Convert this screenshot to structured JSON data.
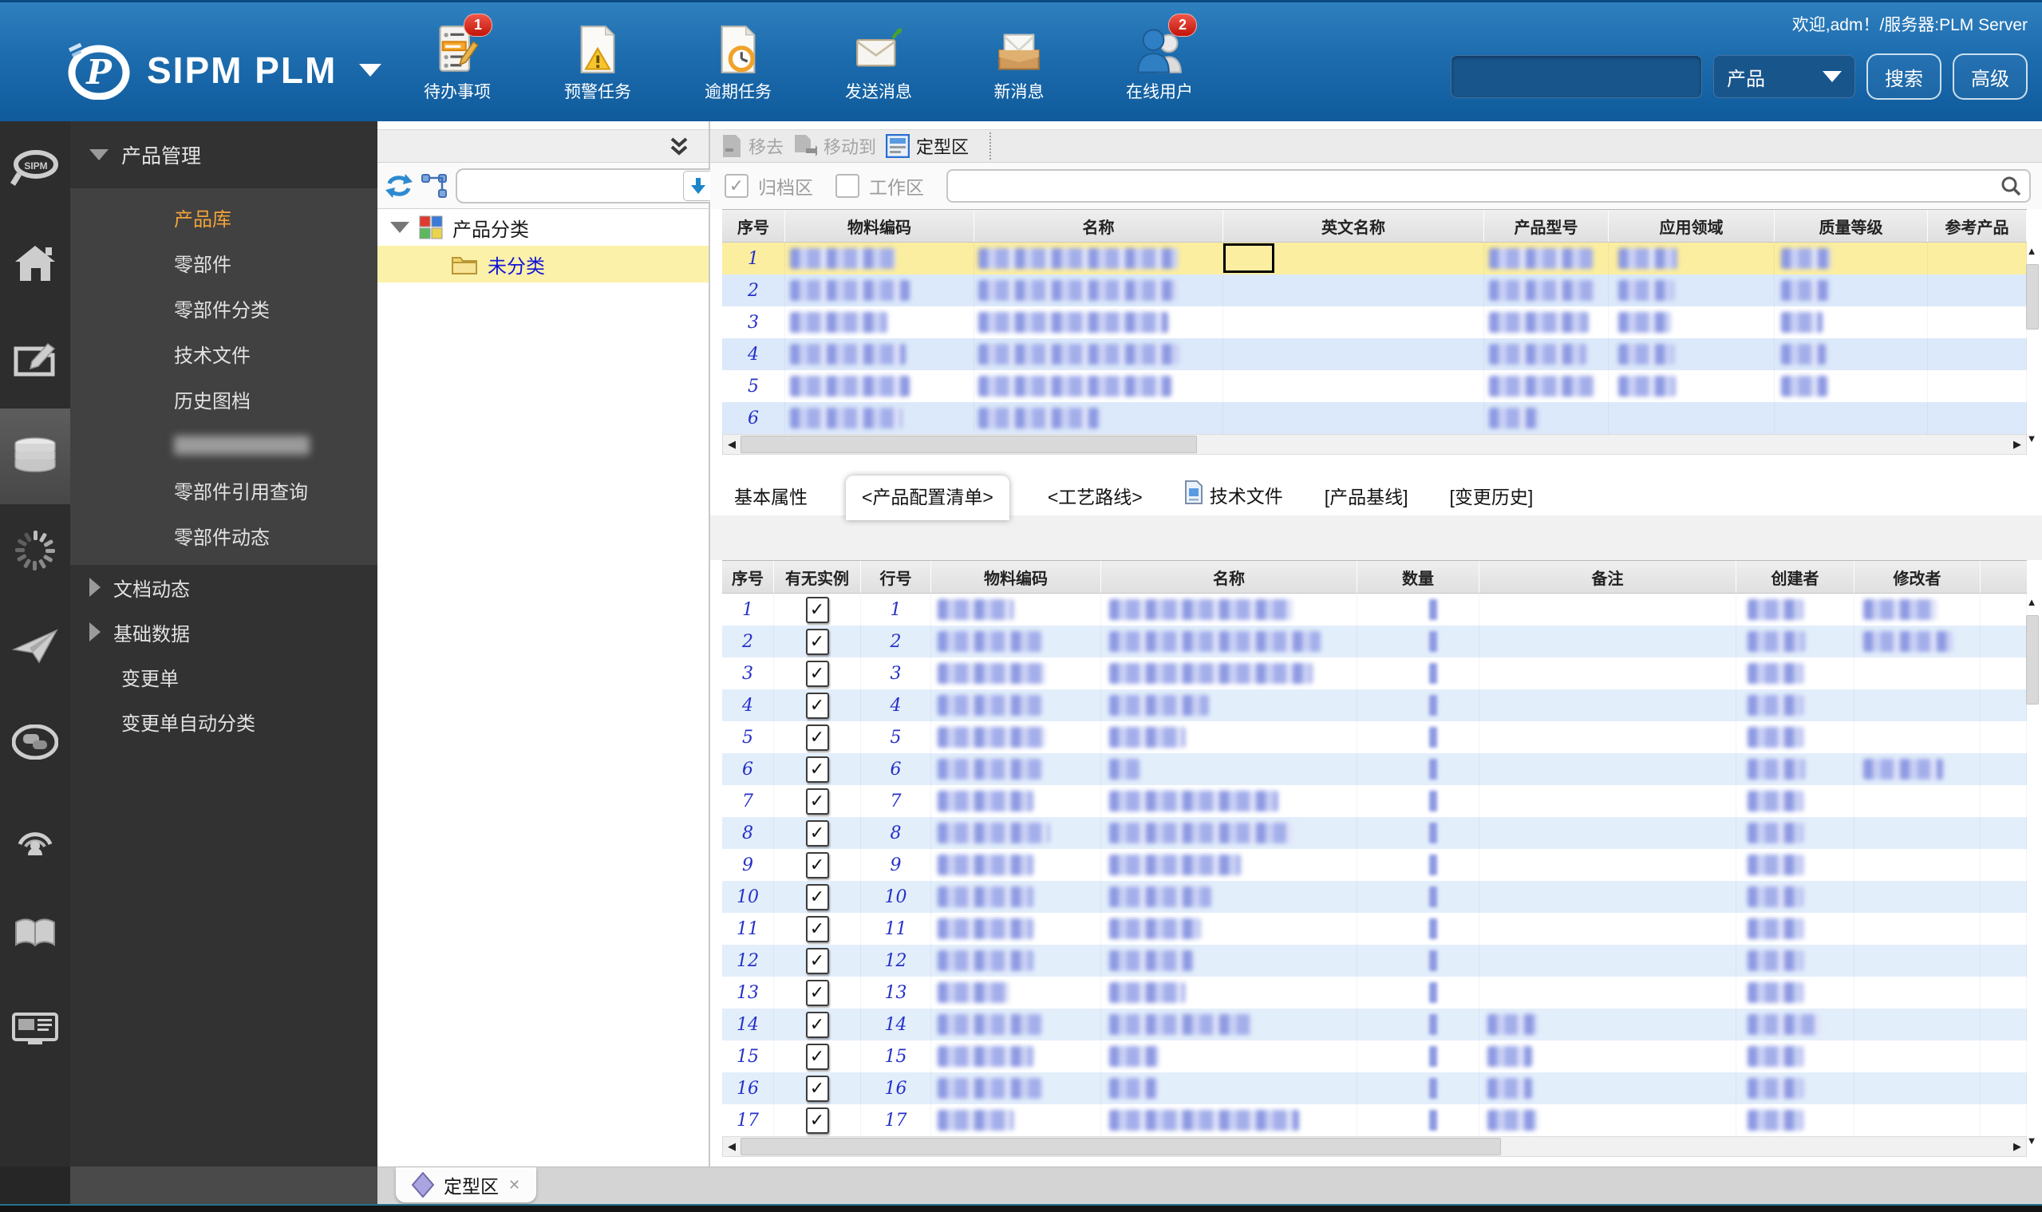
{
  "header": {
    "logo_text": "SIPM PLM",
    "welcome_text": "欢迎,adm！/服务器:PLM Server",
    "toolbar_items": [
      {
        "label": "待办事项",
        "icon": "todo-list-icon",
        "badge": "1"
      },
      {
        "label": "预警任务",
        "icon": "alert-task-icon",
        "badge": ""
      },
      {
        "label": "逾期任务",
        "icon": "overdue-task-icon",
        "badge": ""
      },
      {
        "label": "发送消息",
        "icon": "send-message-icon",
        "badge": ""
      },
      {
        "label": "新消息",
        "icon": "new-message-icon",
        "badge": ""
      },
      {
        "label": "在线用户",
        "icon": "online-users-icon",
        "badge": "2"
      }
    ],
    "search": {
      "value": "",
      "category": "产品",
      "search_btn": "搜索",
      "advanced_btn": "高级"
    }
  },
  "iconbar": {
    "items": [
      {
        "name": "sipm-search-icon",
        "selected": false
      },
      {
        "name": "home-icon",
        "selected": false
      },
      {
        "name": "edit-icon",
        "selected": false
      },
      {
        "name": "database-icon",
        "selected": true
      },
      {
        "name": "spinner-icon",
        "selected": false
      },
      {
        "name": "send-plane-icon",
        "selected": false
      },
      {
        "name": "chat-icon",
        "selected": false
      },
      {
        "name": "broadcast-icon",
        "selected": false
      },
      {
        "name": "book-icon",
        "selected": false
      },
      {
        "name": "workstation-icon",
        "selected": false
      }
    ]
  },
  "sidebar": {
    "root": {
      "label": "产品管理",
      "expanded": true
    },
    "children": [
      {
        "label": "产品库",
        "active": true,
        "redacted": false
      },
      {
        "label": "零部件",
        "active": false,
        "redacted": false
      },
      {
        "label": "零部件分类",
        "active": false,
        "redacted": false
      },
      {
        "label": "技术文件",
        "active": false,
        "redacted": false
      },
      {
        "label": "历史图档",
        "active": false,
        "redacted": false
      },
      {
        "label": "",
        "active": false,
        "redacted": true
      },
      {
        "label": "零部件引用查询",
        "active": false,
        "redacted": false
      },
      {
        "label": "零部件动态",
        "active": false,
        "redacted": false
      }
    ],
    "sections": [
      {
        "label": "文档动态",
        "collapsed": true
      },
      {
        "label": "基础数据",
        "collapsed": true
      },
      {
        "label": "变更单",
        "collapsed": false
      },
      {
        "label": "变更单自动分类",
        "collapsed": false
      }
    ]
  },
  "tree": {
    "root_label": "产品分类",
    "child_label": "未分类"
  },
  "content": {
    "toolbar": {
      "remove": "移去",
      "move_to": "移动到",
      "typed_area": "定型区"
    },
    "filter": {
      "archive": "归档区",
      "work": "工作区",
      "archive_checked": true,
      "work_checked": false,
      "search_value": ""
    },
    "main_table": {
      "columns": [
        "序号",
        "物料编码",
        "名称",
        "英文名称",
        "产品型号",
        "应用领域",
        "质量等级",
        "参考产品"
      ],
      "rows": [
        {
          "num": "1",
          "selected": true,
          "focus": true,
          "code": 132,
          "name": 250,
          "model": 130,
          "domain": 74,
          "grade": 62
        },
        {
          "num": "2",
          "selected": false,
          "focus": false,
          "code": 150,
          "name": 248,
          "model": 135,
          "domain": 70,
          "grade": 60
        },
        {
          "num": "3",
          "selected": false,
          "focus": false,
          "code": 122,
          "name": 238,
          "model": 125,
          "domain": 66,
          "grade": 52
        },
        {
          "num": "4",
          "selected": false,
          "focus": false,
          "code": 145,
          "name": 252,
          "model": 122,
          "domain": 70,
          "grade": 56
        },
        {
          "num": "5",
          "selected": false,
          "focus": false,
          "code": 150,
          "name": 242,
          "model": 132,
          "domain": 72,
          "grade": 58
        },
        {
          "num": "6",
          "selected": false,
          "focus": false,
          "code": 140,
          "name": 152,
          "model": 62,
          "domain": 0,
          "grade": 0
        }
      ]
    },
    "tabs": {
      "items": [
        "基本属性",
        "<产品配置清单>",
        "<工艺路线>",
        "技术文件",
        "[产品基线]",
        "[变更历史]"
      ],
      "selected_index": 1,
      "doc_icon_index": 3
    },
    "bom_table": {
      "columns": [
        "序号",
        "有无实例",
        "行号",
        "物料编码",
        "名称",
        "数量",
        "备注",
        "创建者",
        "修改者"
      ],
      "rows": [
        {
          "num": "1",
          "line": "1",
          "checked": true,
          "code": 95,
          "name": 230,
          "qty": 10,
          "note": 0,
          "creator": 70,
          "modifier": 92
        },
        {
          "num": "2",
          "line": "2",
          "checked": true,
          "code": 130,
          "name": 265,
          "qty": 10,
          "note": 0,
          "creator": 72,
          "modifier": 112
        },
        {
          "num": "3",
          "line": "3",
          "checked": true,
          "code": 135,
          "name": 255,
          "qty": 10,
          "note": 0,
          "creator": 70,
          "modifier": 0
        },
        {
          "num": "4",
          "line": "4",
          "checked": true,
          "code": 130,
          "name": 125,
          "qty": 10,
          "note": 0,
          "creator": 70,
          "modifier": 0
        },
        {
          "num": "5",
          "line": "5",
          "checked": true,
          "code": 135,
          "name": 95,
          "qty": 10,
          "note": 0,
          "creator": 70,
          "modifier": 0
        },
        {
          "num": "6",
          "line": "6",
          "checked": true,
          "code": 130,
          "name": 38,
          "qty": 10,
          "note": 0,
          "creator": 72,
          "modifier": 100
        },
        {
          "num": "7",
          "line": "7",
          "checked": true,
          "code": 120,
          "name": 212,
          "qty": 10,
          "note": 0,
          "creator": 70,
          "modifier": 0
        },
        {
          "num": "8",
          "line": "8",
          "checked": true,
          "code": 140,
          "name": 230,
          "qty": 10,
          "note": 0,
          "creator": 70,
          "modifier": 0
        },
        {
          "num": "9",
          "line": "9",
          "checked": true,
          "code": 120,
          "name": 165,
          "qty": 10,
          "note": 0,
          "creator": 70,
          "modifier": 0
        },
        {
          "num": "10",
          "line": "10",
          "checked": true,
          "code": 120,
          "name": 128,
          "qty": 10,
          "note": 0,
          "creator": 70,
          "modifier": 0
        },
        {
          "num": "11",
          "line": "11",
          "checked": true,
          "code": 120,
          "name": 115,
          "qty": 10,
          "note": 0,
          "creator": 70,
          "modifier": 0
        },
        {
          "num": "12",
          "line": "12",
          "checked": true,
          "code": 120,
          "name": 105,
          "qty": 10,
          "note": 0,
          "creator": 70,
          "modifier": 0
        },
        {
          "num": "13",
          "line": "13",
          "checked": true,
          "code": 90,
          "name": 95,
          "qty": 10,
          "note": 0,
          "creator": 70,
          "modifier": 0
        },
        {
          "num": "14",
          "line": "14",
          "checked": true,
          "code": 130,
          "name": 178,
          "qty": 10,
          "note": 62,
          "creator": 92,
          "modifier": 0
        },
        {
          "num": "15",
          "line": "15",
          "checked": true,
          "code": 120,
          "name": 62,
          "qty": 10,
          "note": 56,
          "creator": 70,
          "modifier": 0
        },
        {
          "num": "16",
          "line": "16",
          "checked": true,
          "code": 130,
          "name": 60,
          "qty": 10,
          "note": 56,
          "creator": 70,
          "modifier": 0
        },
        {
          "num": "17",
          "line": "17",
          "checked": true,
          "code": 95,
          "name": 238,
          "qty": 10,
          "note": 62,
          "creator": 70,
          "modifier": 0
        }
      ]
    }
  },
  "bottombar": {
    "tab_label": "定型区"
  }
}
